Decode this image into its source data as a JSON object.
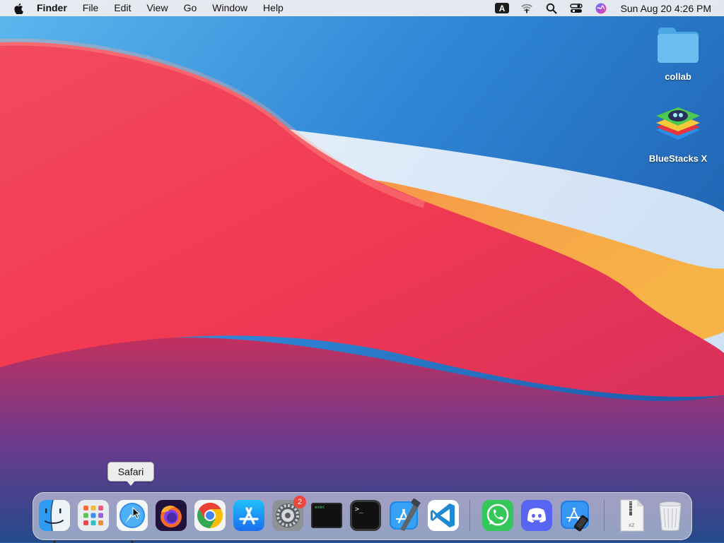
{
  "menubar": {
    "app_name": "Finder",
    "menus": [
      "File",
      "Edit",
      "View",
      "Go",
      "Window",
      "Help"
    ],
    "input_source": "A",
    "clock": "Sun Aug 20  4:26 PM"
  },
  "desktop": {
    "icons": [
      {
        "label": "collab",
        "icon": "folder-icon"
      },
      {
        "label": "BlueStacks X",
        "icon": "bluestacks-icon"
      }
    ]
  },
  "tooltip": {
    "text": "Safari"
  },
  "dock": {
    "items": [
      {
        "name": "Finder",
        "icon": "finder-icon",
        "running": true
      },
      {
        "name": "Launchpad",
        "icon": "launchpad-icon"
      },
      {
        "name": "Safari",
        "icon": "safari-icon",
        "running": true
      },
      {
        "name": "Firefox",
        "icon": "firefox-icon"
      },
      {
        "name": "Google Chrome",
        "icon": "chrome-icon"
      },
      {
        "name": "App Store",
        "icon": "app-store-icon"
      },
      {
        "name": "System Settings",
        "icon": "settings-icon",
        "badge": "2"
      },
      {
        "name": "exec",
        "icon": "exec-terminal-icon",
        "label": "exec"
      },
      {
        "name": "Terminal",
        "icon": "terminal-icon",
        "label": ">_"
      },
      {
        "name": "Xcode",
        "icon": "xcode-icon"
      },
      {
        "name": "Visual Studio Code",
        "icon": "vscode-icon"
      },
      {
        "name": "WhatsApp",
        "icon": "whatsapp-icon"
      },
      {
        "name": "Discord",
        "icon": "discord-icon"
      },
      {
        "name": "Simulator",
        "icon": "simulator-icon"
      },
      {
        "name": "Archive",
        "icon": "zip-archive-icon",
        "label": "XZ"
      },
      {
        "name": "Trash",
        "icon": "trash-icon"
      }
    ]
  },
  "colors": {
    "sky_blue": "#2f7fd0",
    "red": "#f2374f",
    "orange": "#f7a046",
    "purple": "#6a3f8f"
  }
}
